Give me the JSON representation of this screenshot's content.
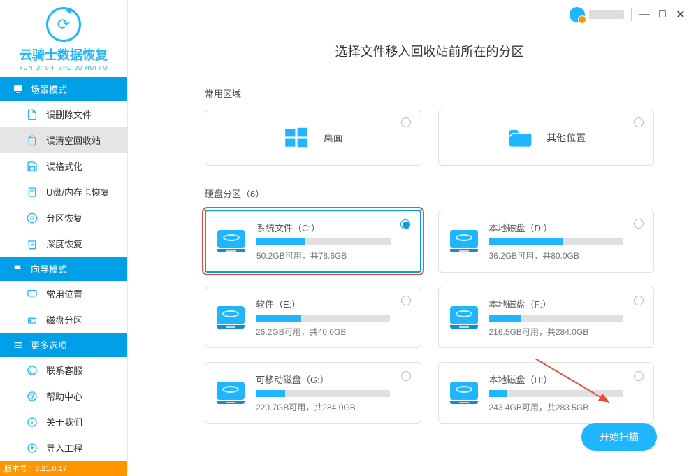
{
  "brand": {
    "title": "云骑士数据恢复",
    "subtitle": "YUN QI SHI SHU JU HUI FU"
  },
  "titlebar": {
    "minimize": "—",
    "maximize": "□",
    "close": "✕"
  },
  "sidebar": {
    "scene_header": "场景模式",
    "wizard_header": "向导模式",
    "more_header": "更多选项",
    "scene_items": [
      {
        "label": "误删除文件"
      },
      {
        "label": "误清空回收站"
      },
      {
        "label": "误格式化"
      },
      {
        "label": "U盘/内存卡恢复"
      },
      {
        "label": "分区恢复"
      },
      {
        "label": "深度恢复"
      }
    ],
    "wizard_items": [
      {
        "label": "常用位置"
      },
      {
        "label": "磁盘分区"
      }
    ],
    "more_items": [
      {
        "label": "联系客服"
      },
      {
        "label": "帮助中心"
      },
      {
        "label": "关于我们"
      },
      {
        "label": "导入工程"
      }
    ]
  },
  "version_label": "版本号：3.21.0.17",
  "main": {
    "title": "选择文件移入回收站前所在的分区",
    "common_label": "常用区域",
    "disk_label": "硬盘分区（6）",
    "common_areas": [
      {
        "label": "桌面"
      },
      {
        "label": "其他位置"
      }
    ],
    "disks": [
      {
        "name": "系统文件（C:）",
        "stats": "50.2GB可用，共78.6GB",
        "used_pct": 36,
        "selected": true
      },
      {
        "name": "本地磁盘（D:）",
        "stats": "36.2GB可用，共80.0GB",
        "used_pct": 55,
        "selected": false
      },
      {
        "name": "软件（E:）",
        "stats": "26.2GB可用，共40.0GB",
        "used_pct": 34,
        "selected": false
      },
      {
        "name": "本地磁盘（F:）",
        "stats": "216.5GB可用，共284.0GB",
        "used_pct": 24,
        "selected": false
      },
      {
        "name": "可移动磁盘（G:）",
        "stats": "220.7GB可用，共284.0GB",
        "used_pct": 22,
        "selected": false
      },
      {
        "name": "本地磁盘（H:）",
        "stats": "243.4GB可用，共283.5GB",
        "used_pct": 14,
        "selected": false
      }
    ],
    "scan_button": "开始扫描"
  }
}
